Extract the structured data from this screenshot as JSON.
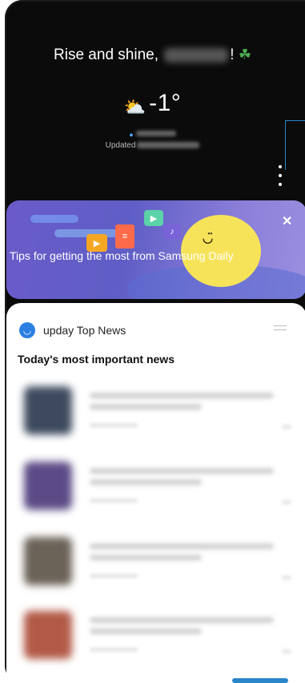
{
  "header": {
    "greeting_prefix": "Rise and shine,",
    "greeting_suffix": "!"
  },
  "weather": {
    "temperature": "-1°",
    "updated_label": "Updated"
  },
  "tips_card": {
    "text": "Tips for getting the most from Samsung Daily",
    "close_glyph": "✕"
  },
  "news": {
    "source_title": "upday Top News",
    "subtitle": "Today's most important news",
    "items": [
      {
        "thumb_color": "#3d4a5e"
      },
      {
        "thumb_color": "#5b4a86"
      },
      {
        "thumb_color": "#6b6258"
      },
      {
        "thumb_color": "#b25a47"
      }
    ]
  },
  "colors": {
    "accent": "#2a85c9",
    "tips_bg": "#6a5bc9",
    "sun": "#f7e35a"
  }
}
